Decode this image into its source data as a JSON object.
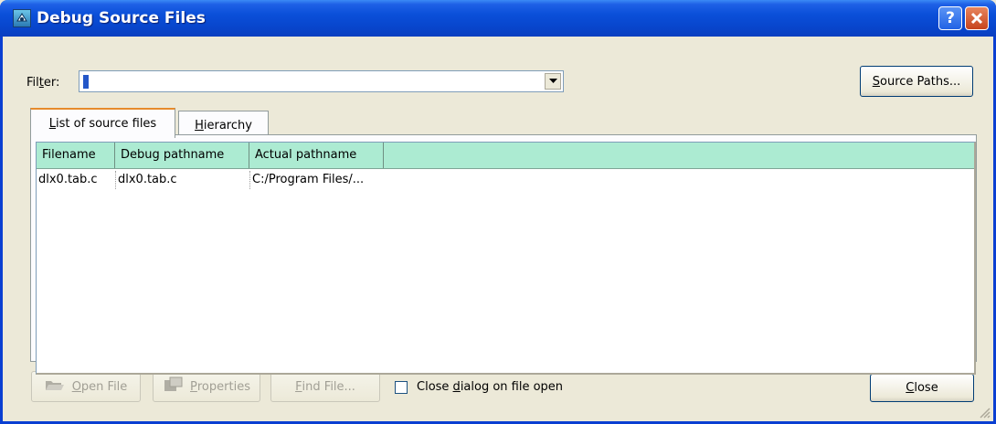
{
  "window": {
    "title": "Debug Source Files",
    "help_button": "?",
    "close_button": "✕"
  },
  "filter": {
    "label_pre": "Fil",
    "label_accel": "t",
    "label_post": "er:",
    "value": ""
  },
  "source_paths_button": {
    "accel": "S",
    "rest": "ource Paths..."
  },
  "tabs": [
    {
      "accel": "L",
      "rest": "ist of source files",
      "active": true
    },
    {
      "accel": "H",
      "rest": "ierarchy",
      "active": false
    }
  ],
  "table": {
    "columns": [
      "Filename",
      "Debug pathname",
      "Actual pathname"
    ],
    "rows": [
      [
        "dlx0.tab.c",
        "dlx0.tab.c",
        "C:/Program Files/..."
      ]
    ]
  },
  "bottom": {
    "open_file": {
      "accel": "O",
      "rest": "pen File",
      "enabled": false,
      "icon": "open-folder-icon"
    },
    "properties": {
      "accel": "P",
      "rest": "roperties",
      "enabled": false,
      "icon": "properties-icon"
    },
    "find_file": {
      "accel": "F",
      "rest": "ind File...",
      "enabled": false
    },
    "close_dialog_check": {
      "pre": "Close ",
      "accel": "d",
      "post": "ialog on file open",
      "checked": false
    },
    "close": {
      "accel": "C",
      "rest": "lose"
    }
  },
  "colors": {
    "title_bar": "#0a4fd9",
    "table_header": "#acebd2",
    "dialog_bg": "#ece9d8",
    "active_tab_accent": "#e68b2c"
  }
}
